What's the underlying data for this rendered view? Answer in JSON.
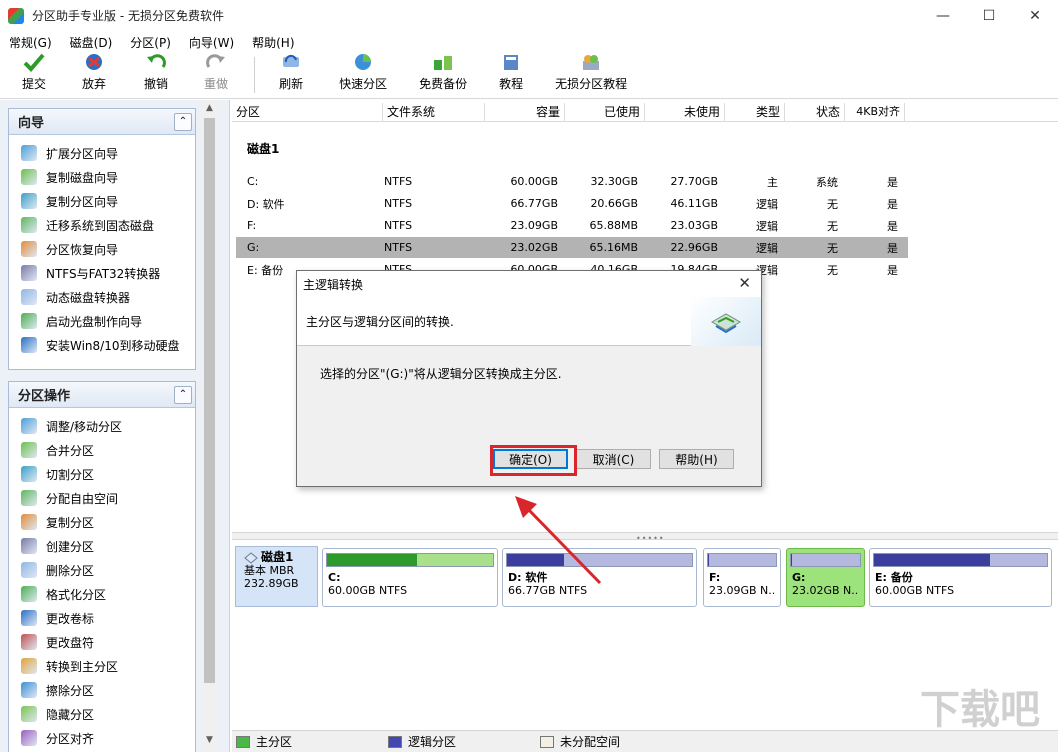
{
  "window": {
    "title": "分区助手专业版 - 无损分区免费软件"
  },
  "menu": [
    "常规(G)",
    "磁盘(D)",
    "分区(P)",
    "向导(W)",
    "帮助(H)"
  ],
  "toolbar": {
    "commit": "提交",
    "discard": "放弃",
    "undo": "撤销",
    "redo": "重做",
    "refresh": "刷新",
    "quick_partition": "快速分区",
    "free_backup": "免费备份",
    "tutorial": "教程",
    "lossless_tutorial": "无损分区教程"
  },
  "wizard_panel": {
    "title": "向导",
    "items": [
      "扩展分区向导",
      "复制磁盘向导",
      "复制分区向导",
      "迁移系统到固态磁盘",
      "分区恢复向导",
      "NTFS与FAT32转换器",
      "动态磁盘转换器",
      "启动光盘制作向导",
      "安装Win8/10到移动硬盘"
    ]
  },
  "ops_panel": {
    "title": "分区操作",
    "items": [
      "调整/移动分区",
      "合并分区",
      "切割分区",
      "分配自由空间",
      "复制分区",
      "创建分区",
      "删除分区",
      "格式化分区",
      "更改卷标",
      "更改盘符",
      "转换到主分区",
      "擦除分区",
      "隐藏分区",
      "分区对齐"
    ]
  },
  "list": {
    "headers": [
      "分区",
      "文件系统",
      "容量",
      "已使用",
      "未使用",
      "类型",
      "状态",
      "4KB对齐"
    ],
    "disk_label": "磁盘1",
    "rows": [
      {
        "name": "C:",
        "fs": "NTFS",
        "cap": "60.00GB",
        "used": "32.30GB",
        "free": "27.70GB",
        "type": "主",
        "status": "系统",
        "align": "是"
      },
      {
        "name": "D: 软件",
        "fs": "NTFS",
        "cap": "66.77GB",
        "used": "20.66GB",
        "free": "46.11GB",
        "type": "逻辑",
        "status": "无",
        "align": "是"
      },
      {
        "name": "F:",
        "fs": "NTFS",
        "cap": "23.09GB",
        "used": "65.88MB",
        "free": "23.03GB",
        "type": "逻辑",
        "status": "无",
        "align": "是"
      },
      {
        "name": "G:",
        "fs": "NTFS",
        "cap": "23.02GB",
        "used": "65.16MB",
        "free": "22.96GB",
        "type": "逻辑",
        "status": "无",
        "align": "是"
      },
      {
        "name": "E: 备份",
        "fs": "NTFS",
        "cap": "60.00GB",
        "used": "40.16GB",
        "free": "19.84GB",
        "type": "逻辑",
        "status": "无",
        "align": "是"
      }
    ]
  },
  "diskmap": {
    "disk": {
      "name": "磁盘1",
      "type": "基本 MBR",
      "size": "232.89GB"
    },
    "partitions": [
      {
        "name": "C:",
        "info": "60.00GB NTFS",
        "used_pct": 54,
        "kind": "primary"
      },
      {
        "name": "D: 软件",
        "info": "66.77GB NTFS",
        "used_pct": 31,
        "kind": "logical"
      },
      {
        "name": "F:",
        "info": "23.09GB N...",
        "used_pct": 1,
        "kind": "logical"
      },
      {
        "name": "G:",
        "info": "23.02GB N...",
        "used_pct": 1,
        "kind": "logical"
      },
      {
        "name": "E: 备份",
        "info": "60.00GB NTFS",
        "used_pct": 67,
        "kind": "logical"
      }
    ]
  },
  "legend": {
    "primary": "主分区",
    "logical": "逻辑分区",
    "unallocated": "未分配空间"
  },
  "dialog": {
    "title": "主逻辑转换",
    "header": "主分区与逻辑分区间的转换.",
    "message": "选择的分区\"(G:)\"将从逻辑分区转换成主分区.",
    "ok": "确定(O)",
    "cancel": "取消(C)",
    "help": "帮助(H)"
  },
  "colors": {
    "primary_bar": "#2e9a2a",
    "logical_bar": "#3c3e9e",
    "selected_part": "#9de37b",
    "annotation": "#d9262d"
  }
}
